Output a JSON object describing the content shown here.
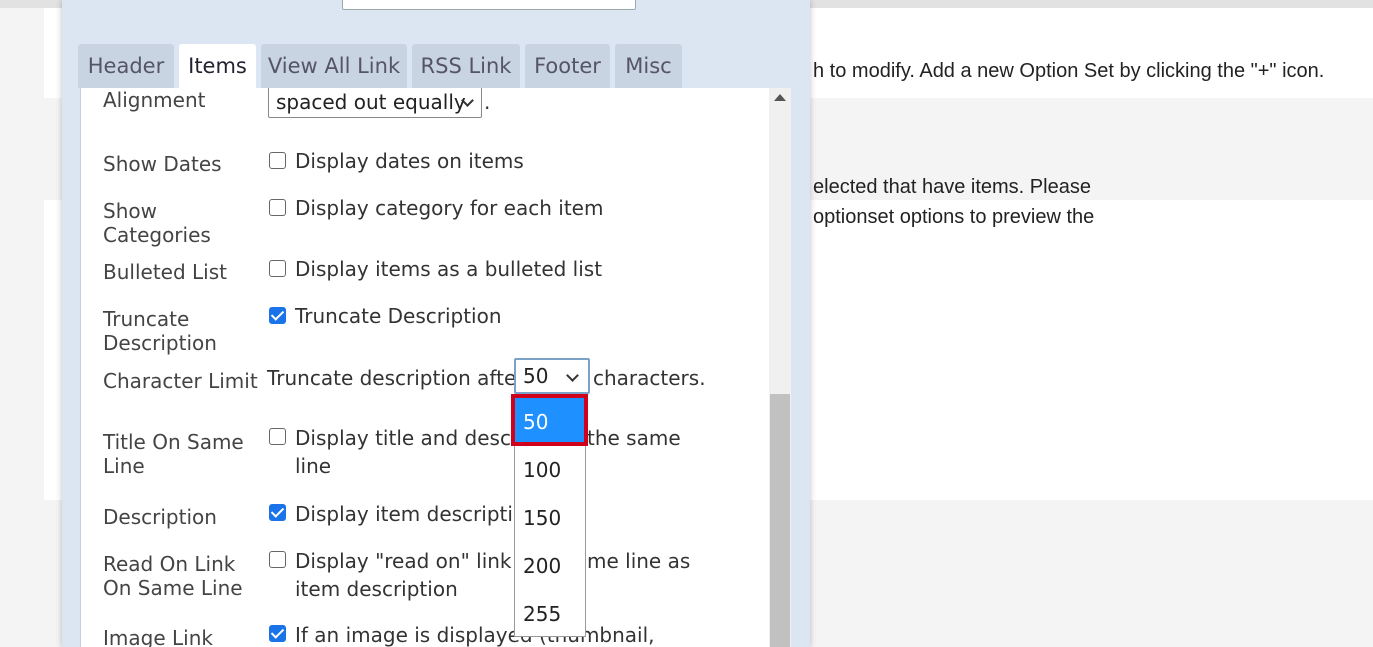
{
  "background": {
    "line1": "h to modify. Add a new Option Set by clicking the \"+\" icon.",
    "line2": "elected that have items. Please",
    "line3": "optionset options to preview the"
  },
  "tabs": [
    "Header",
    "Items",
    "View All Link",
    "RSS Link",
    "Footer",
    "Misc"
  ],
  "active_tab": "Items",
  "form": {
    "alignment": {
      "label": "Alignment",
      "value": "spaced out equally",
      "suffix": "."
    },
    "show_dates": {
      "label": "Show Dates",
      "text": "Display dates on items",
      "checked": false
    },
    "show_categories": {
      "label_1": "Show",
      "label_2": "Categories",
      "text": "Display category for each item",
      "checked": false
    },
    "bulleted_list": {
      "label": "Bulleted List",
      "text": "Display items as a bulleted list",
      "checked": false
    },
    "truncate_description": {
      "label_1": "Truncate",
      "label_2": "Description",
      "text": "Truncate Description",
      "checked": true
    },
    "character_limit": {
      "label": "Character Limit",
      "prefix": "Truncate description after",
      "value": "50",
      "suffix": "characters."
    },
    "title_same_line": {
      "label_1": "Title On Same",
      "label_2": "Line",
      "text_1": "Display title and descrip",
      "text_1b": "the same",
      "text_2": "line",
      "checked": false
    },
    "description": {
      "label": "Description",
      "text": "Display item descriptio",
      "checked": true
    },
    "read_on_link": {
      "label_1": "Read On Link",
      "label_2": "On Same Line",
      "text_1": "Display \"read on\" link o",
      "text_1b": "me line as",
      "text_2": "item description",
      "checked": false
    },
    "image_link": {
      "label": "Image Link",
      "text": "If an image is displayed (thumbnail,",
      "checked": true
    }
  },
  "dropdown": {
    "options": [
      "50",
      "100",
      "150",
      "200",
      "255"
    ],
    "selected": "50"
  },
  "colors": {
    "accent": "#1e90ff",
    "highlight": "#d0021b",
    "modal_bg": "#dce6f2"
  }
}
